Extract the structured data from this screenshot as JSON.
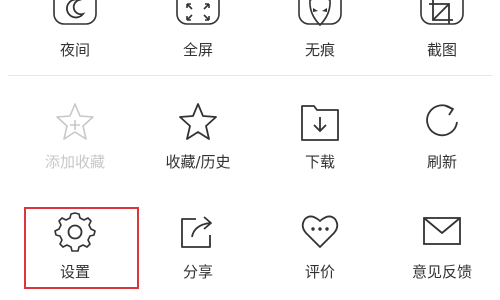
{
  "menu": {
    "row1": [
      {
        "label": "夜间",
        "icon": "moon-icon"
      },
      {
        "label": "全屏",
        "icon": "fullscreen-icon"
      },
      {
        "label": "无痕",
        "icon": "mask-icon"
      },
      {
        "label": "截图",
        "icon": "screenshot-icon"
      }
    ],
    "row2": [
      {
        "label": "添加收藏",
        "icon": "star-add-icon",
        "state": "disabled"
      },
      {
        "label": "收藏/历史",
        "icon": "star-icon"
      },
      {
        "label": "下载",
        "icon": "download-icon"
      },
      {
        "label": "刷新",
        "icon": "refresh-icon"
      }
    ],
    "row3": [
      {
        "label": "设置",
        "icon": "gear-icon",
        "state": "highlighted"
      },
      {
        "label": "分享",
        "icon": "share-icon"
      },
      {
        "label": "评价",
        "icon": "heart-chat-icon"
      },
      {
        "label": "意见反馈",
        "icon": "mail-icon"
      }
    ]
  },
  "colors": {
    "icon_stroke": "#333333",
    "disabled": "#c8c8c8",
    "highlight_border": "#d9363e"
  }
}
